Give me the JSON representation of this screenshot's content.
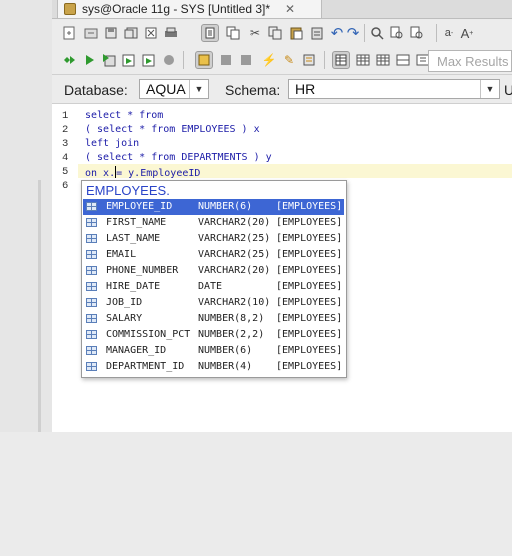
{
  "tab": {
    "title": "sys@Oracle 11g - SYS [Untitled 3]*",
    "close": "✕"
  },
  "toolbar2": {
    "max_rows_placeholder": "Max Results"
  },
  "connection": {
    "database_label": "Database:",
    "database_value": "AQUA",
    "schema_label": "Schema:",
    "schema_value": "HR",
    "right_label": "U"
  },
  "editor": {
    "line_numbers": [
      "1",
      "2",
      "3",
      "4",
      "5",
      "6"
    ],
    "lines": [
      "select * from",
      "( select * from EMPLOYEES ) x",
      "left join",
      "( select * from DEPARTMENTS ) y",
      "on x.",
      ""
    ],
    "line5_after_caret": "= y.EmployeeID"
  },
  "autocomplete": {
    "header": "EMPLOYEES.",
    "rows": [
      {
        "name": "EMPLOYEE_ID",
        "type": "NUMBER(6)",
        "table": "[EMPLOYEES]"
      },
      {
        "name": "FIRST_NAME",
        "type": "VARCHAR2(20)",
        "table": "[EMPLOYEES]"
      },
      {
        "name": "LAST_NAME",
        "type": "VARCHAR2(25)",
        "table": "[EMPLOYEES]"
      },
      {
        "name": "EMAIL",
        "type": "VARCHAR2(25)",
        "table": "[EMPLOYEES]"
      },
      {
        "name": "PHONE_NUMBER",
        "type": "VARCHAR2(20)",
        "table": "[EMPLOYEES]"
      },
      {
        "name": "HIRE_DATE",
        "type": "DATE",
        "table": "[EMPLOYEES]"
      },
      {
        "name": "JOB_ID",
        "type": "VARCHAR2(10)",
        "table": "[EMPLOYEES]"
      },
      {
        "name": "SALARY",
        "type": "NUMBER(8,2)",
        "table": "[EMPLOYEES]"
      },
      {
        "name": "COMMISSION_PCT",
        "type": "NUMBER(2,2)",
        "table": "[EMPLOYEES]"
      },
      {
        "name": "MANAGER_ID",
        "type": "NUMBER(6)",
        "table": "[EMPLOYEES]"
      },
      {
        "name": "DEPARTMENT_ID",
        "type": "NUMBER(4)",
        "table": "[EMPLOYEES]"
      }
    ]
  },
  "colors": {
    "keyword": "#1c1ca8",
    "selection": "#3d66d4",
    "popup_header": "#2a44c8",
    "current_line": "#fbf7d3"
  }
}
